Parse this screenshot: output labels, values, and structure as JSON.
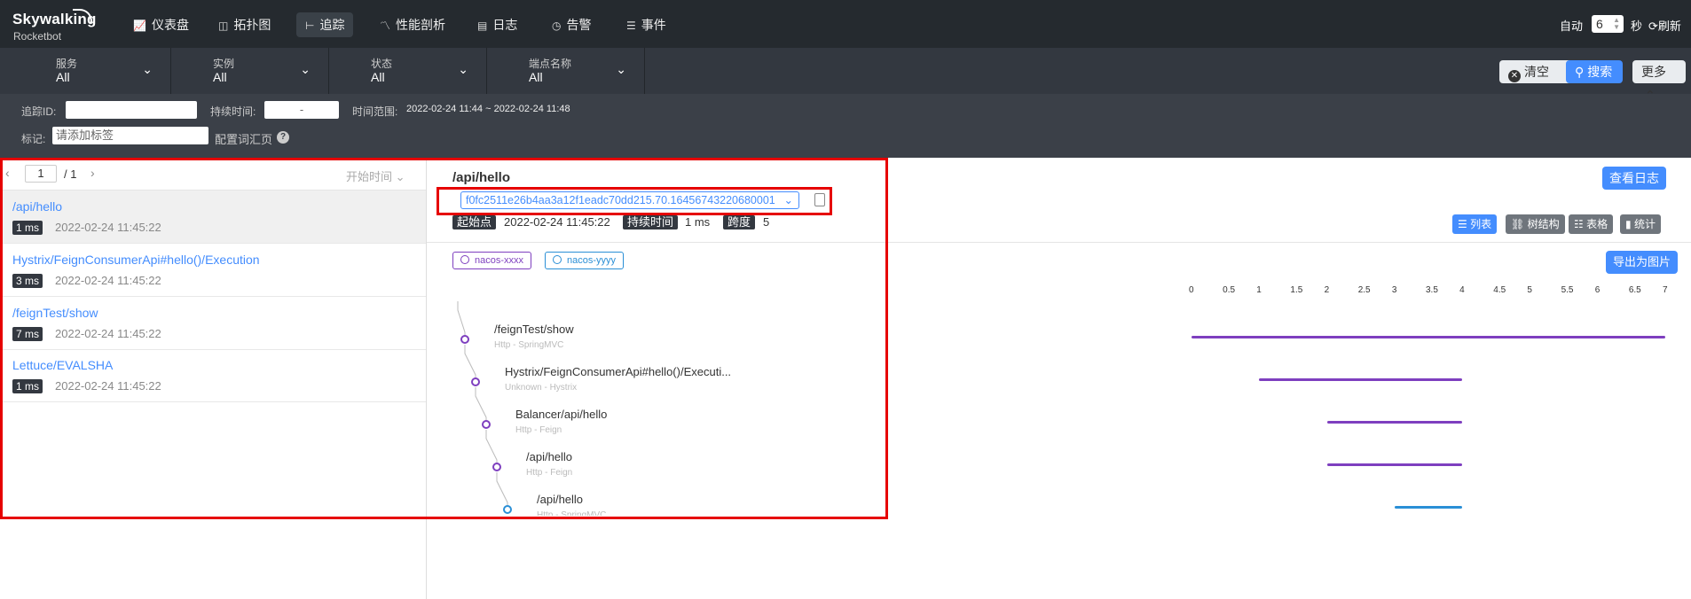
{
  "brand": {
    "logo": "Skywalking",
    "subtitle": "Rocketbot"
  },
  "nav": [
    {
      "label": "仪表盘",
      "icon": "chart-icon"
    },
    {
      "label": "拓扑图",
      "icon": "topology-icon"
    },
    {
      "label": "追踪",
      "icon": "trace-icon",
      "active": true
    },
    {
      "label": "性能剖析",
      "icon": "profile-icon"
    },
    {
      "label": "日志",
      "icon": "log-icon"
    },
    {
      "label": "告警",
      "icon": "alarm-icon"
    },
    {
      "label": "事件",
      "icon": "event-icon"
    }
  ],
  "auto_refresh": {
    "label": "自动",
    "value": "6",
    "unit": "秒",
    "refresh": "刷新"
  },
  "filters": [
    {
      "label": "服务",
      "value": "All"
    },
    {
      "label": "实例",
      "value": "All"
    },
    {
      "label": "状态",
      "value": "All"
    },
    {
      "label": "端点名称",
      "value": "All"
    }
  ],
  "filter_actions": {
    "clear": "清空",
    "search": "搜索",
    "more": "更多"
  },
  "filter_panel": {
    "trace_id_label": "追踪ID:",
    "trace_id_value": "",
    "duration_label": "持续时间:",
    "duration_value": "-",
    "time_range_label": "时间范围:",
    "time_range_value": "2022-02-24 11:44 ~ 2022-02-24 11:48",
    "tag_label": "标记:",
    "tag_placeholder": "请添加标签",
    "config_label": "配置词汇页"
  },
  "pager": {
    "page": "1",
    "total": "/ 1",
    "sort": "开始时间"
  },
  "traces": [
    {
      "title": "/api/hello",
      "duration": "1 ms",
      "time": "2022-02-24 11:45:22"
    },
    {
      "title": "Hystrix/FeignConsumerApi#hello()/Execution",
      "duration": "3 ms",
      "time": "2022-02-24 11:45:22"
    },
    {
      "title": "/feignTest/show",
      "duration": "7 ms",
      "time": "2022-02-24 11:45:22"
    },
    {
      "title": "Lettuce/EVALSHA",
      "duration": "1 ms",
      "time": "2022-02-24 11:45:22"
    }
  ],
  "detail": {
    "title": "/api/hello",
    "trace_id": "f0fc2511e26b4aa3a12f1eadc70dd215.70.16456743220680001",
    "start_label": "起始点",
    "start_value": "2022-02-24 11:45:22",
    "duration_label": "持续时间",
    "duration_value": "1 ms",
    "span_label": "跨度",
    "span_value": "5",
    "view_log": "查看日志",
    "export": "导出为图片",
    "views": [
      "列表",
      "树结构",
      "表格",
      "统计"
    ],
    "services": [
      {
        "name": "nacos-xxxx",
        "color": "#7e3fbf"
      },
      {
        "name": "nacos-yyyy",
        "color": "#2a8fd6"
      }
    ],
    "ticks": [
      "0",
      "0.5",
      "1",
      "1.5",
      "2",
      "2.5",
      "3",
      "3.5",
      "4",
      "4.5",
      "5",
      "5.5",
      "6",
      "6.5",
      "7"
    ],
    "spans": [
      {
        "name": "/feignTest/show",
        "sub": "Http - SpringMVC",
        "start": 0,
        "end": 7,
        "color": "#7e3fbf"
      },
      {
        "name": "Hystrix/FeignConsumerApi#hello()/Executi...",
        "sub": "Unknown - Hystrix",
        "start": 1,
        "end": 4,
        "color": "#7e3fbf"
      },
      {
        "name": "Balancer/api/hello",
        "sub": "Http - Feign",
        "start": 2,
        "end": 4,
        "color": "#7e3fbf"
      },
      {
        "name": "/api/hello",
        "sub": "Http - Feign",
        "start": 2,
        "end": 4,
        "color": "#7e3fbf"
      },
      {
        "name": "/api/hello",
        "sub": "Http - SpringMVC",
        "start": 3,
        "end": 4,
        "color": "#2a8fd6"
      }
    ]
  }
}
